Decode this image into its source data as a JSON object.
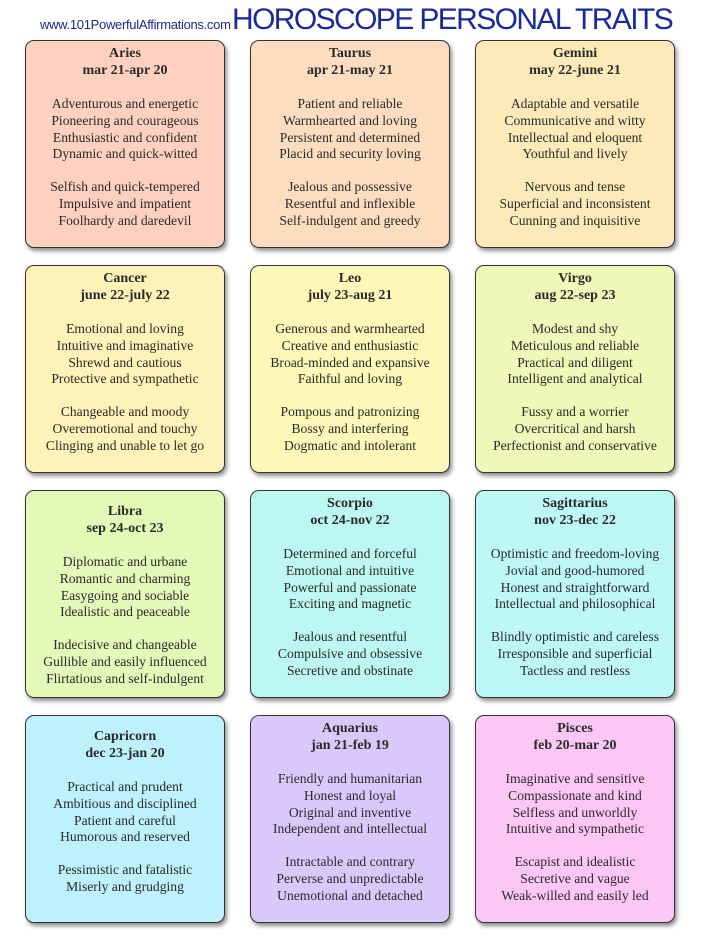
{
  "header": {
    "site": "www.101PowerfulAffirmations.com",
    "title": "HOROSCOPE PERSONAL TRAITS"
  },
  "signs": [
    {
      "name": "Aries",
      "dates": "mar 21-apr 20",
      "color": "#fdd0bf",
      "positive": [
        "Adventurous and energetic",
        "Pioneering and courageous",
        "Enthusiastic and confident",
        "Dynamic and quick-witted"
      ],
      "negative": [
        "Selfish and quick-tempered",
        "Impulsive and impatient",
        "Foolhardy and daredevil"
      ]
    },
    {
      "name": "Taurus",
      "dates": "apr 21-may 21",
      "color": "#fdddbf",
      "positive": [
        "Patient and reliable",
        "Warmhearted and loving",
        "Persistent and determined",
        "Placid and security loving"
      ],
      "negative": [
        "Jealous and possessive",
        "Resentful and inflexible",
        "Self-indulgent and greedy"
      ]
    },
    {
      "name": "Gemini",
      "dates": "may 22-june 21",
      "color": "#fdeab8",
      "positive": [
        "Adaptable and versatile",
        "Communicative and witty",
        "Intellectual and eloquent",
        "Youthful and lively"
      ],
      "negative": [
        "Nervous and tense",
        "Superficial and inconsistent",
        "Cunning and inquisitive"
      ]
    },
    {
      "name": "Cancer",
      "dates": "june 22-july 22",
      "color": "#fdf3b8",
      "positive": [
        "Emotional and loving",
        "Intuitive and imaginative",
        "Shrewd and cautious",
        "Protective and sympathetic"
      ],
      "negative": [
        "Changeable and moody",
        "Overemotional and touchy",
        "Clinging and unable to let go"
      ]
    },
    {
      "name": "Leo",
      "dates": "july 23-aug 21",
      "color": "#fdf7b8",
      "positive": [
        "Generous and warmhearted",
        "Creative and enthusiastic",
        "Broad-minded and expansive",
        "Faithful and loving"
      ],
      "negative": [
        "Pompous and patronizing",
        "Bossy and interfering",
        "Dogmatic and intolerant"
      ]
    },
    {
      "name": "Virgo",
      "dates": "aug 22-sep 23",
      "color": "#eef8b8",
      "positive": [
        "Modest and shy",
        "Meticulous and reliable",
        "Practical and diligent",
        "Intelligent and analytical"
      ],
      "negative": [
        "Fussy and a worrier",
        "Overcritical and harsh",
        "Perfectionist and conservative"
      ]
    },
    {
      "name": "Libra",
      "dates": "sep 24-oct 23",
      "color": "#e4f8b8",
      "positive": [
        "Diplomatic and urbane",
        "Romantic and charming",
        "Easygoing and sociable",
        "Idealistic and peaceable"
      ],
      "negative": [
        "Indecisive and changeable",
        "Gullible and easily influenced",
        "Flirtatious and self-indulgent"
      ]
    },
    {
      "name": "Scorpio",
      "dates": "oct 24-nov 22",
      "color": "#bdf7f2",
      "positive": [
        "Determined and forceful",
        "Emotional and intuitive",
        "Powerful and passionate",
        "Exciting and magnetic"
      ],
      "negative": [
        "Jealous and resentful",
        "Compulsive and obsessive",
        "Secretive and obstinate"
      ]
    },
    {
      "name": "Sagittarius",
      "dates": "nov 23-dec 22",
      "color": "#bdf7f6",
      "positive": [
        "Optimistic and freedom-loving",
        "Jovial and good-humored",
        "Honest and straightforward",
        "Intellectual and philosophical"
      ],
      "negative": [
        "Blindly optimistic and careless",
        "Irresponsible and superficial",
        "Tactless and restless"
      ]
    },
    {
      "name": "Capricorn",
      "dates": "dec 23-jan 20",
      "color": "#bdf1fb",
      "positive": [
        "Practical and prudent",
        "Ambitious and disciplined",
        "Patient and careful",
        "Humorous and reserved"
      ],
      "negative": [
        "Pessimistic and fatalistic",
        "Miserly and grudging"
      ]
    },
    {
      "name": "Aquarius",
      "dates": "jan 21-feb 19",
      "color": "#d9c9fb",
      "positive": [
        "Friendly and humanitarian",
        "Honest and loyal",
        "Original and inventive",
        "Independent and intellectual"
      ],
      "negative": [
        "Intractable and contrary",
        "Perverse and unpredictable",
        "Unemotional and detached"
      ]
    },
    {
      "name": "Pisces",
      "dates": "feb 20-mar 20",
      "color": "#fcc6f5",
      "positive": [
        "Imaginative and sensitive",
        "Compassionate and kind",
        "Selfless and unworldly",
        "Intuitive and sympathetic"
      ],
      "negative": [
        "Escapist and idealistic",
        "Secretive and vague",
        "Weak-willed and easily led"
      ]
    }
  ]
}
